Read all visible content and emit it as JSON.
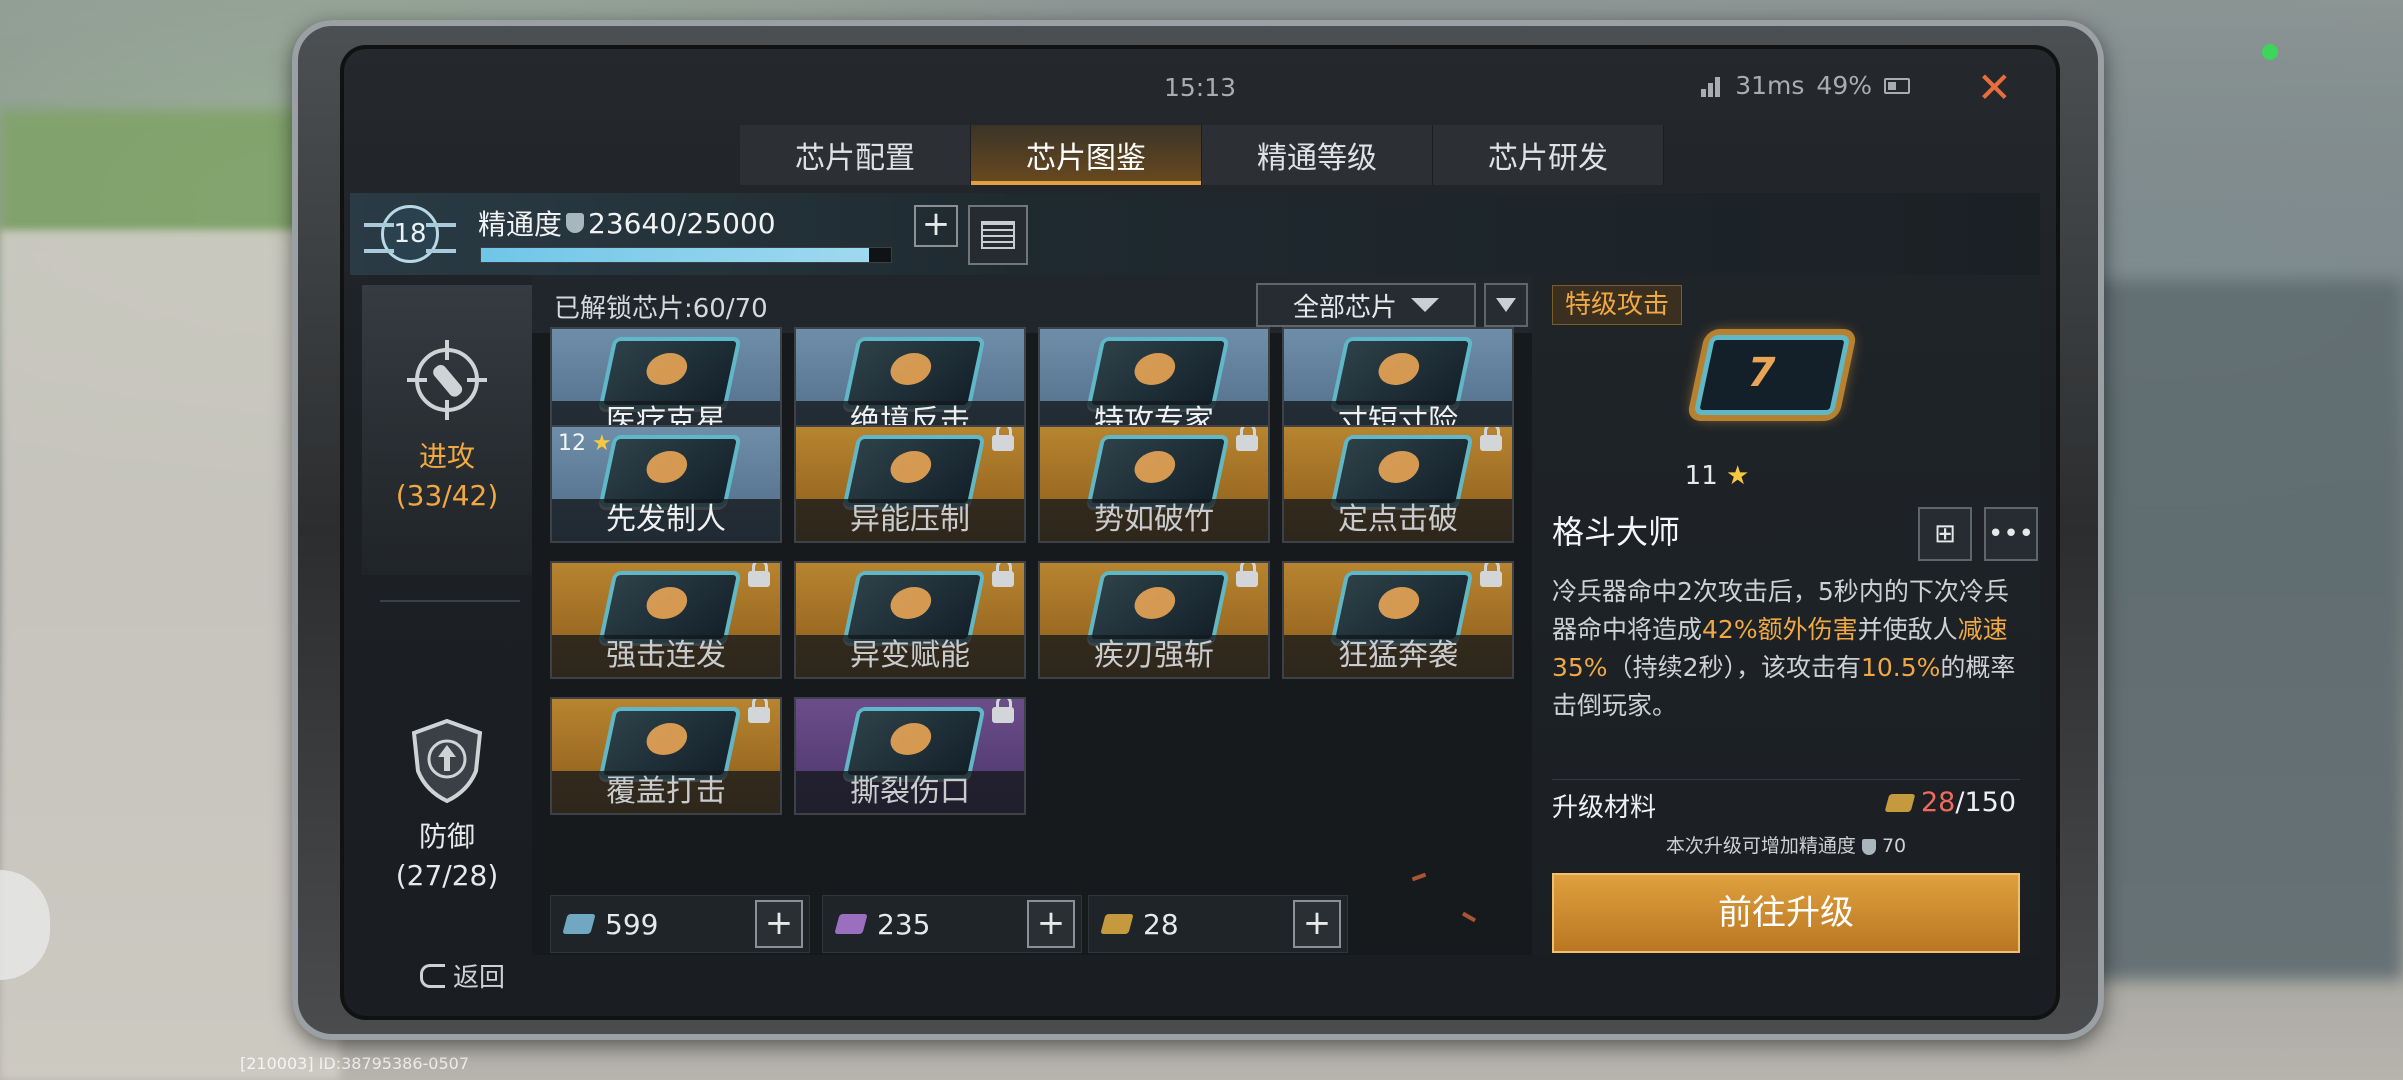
{
  "status": {
    "time": "15:13",
    "ping": "31ms",
    "battery": "49%"
  },
  "tabs": [
    {
      "label": "芯片配置",
      "active": false
    },
    {
      "label": "芯片图鉴",
      "active": true
    },
    {
      "label": "精通等级",
      "active": false
    },
    {
      "label": "芯片研发",
      "active": false
    }
  ],
  "header": {
    "level": "18",
    "mastery_label": "精通度",
    "mastery_value": "23640/25000",
    "mastery_progress": 0.9456
  },
  "categories": [
    {
      "name": "进攻",
      "count": "(33/42)",
      "active": true
    },
    {
      "name": "防御",
      "count": "(27/28)",
      "active": false
    }
  ],
  "grid": {
    "unlocked_text": "已解锁芯片:60/70",
    "filter_label": "全部芯片",
    "cards": [
      {
        "name": "医疗克星",
        "color": "blue",
        "locked": false,
        "stars": ""
      },
      {
        "name": "绝境反击",
        "color": "blue",
        "locked": false,
        "stars": ""
      },
      {
        "name": "特攻专家",
        "color": "blue",
        "locked": false,
        "stars": ""
      },
      {
        "name": "寸短寸险",
        "color": "blue",
        "locked": false,
        "stars": ""
      },
      {
        "name": "先发制人",
        "color": "blue",
        "locked": false,
        "stars": "12"
      },
      {
        "name": "异能压制",
        "color": "gold",
        "locked": true,
        "stars": ""
      },
      {
        "name": "势如破竹",
        "color": "gold",
        "locked": true,
        "stars": ""
      },
      {
        "name": "定点击破",
        "color": "gold",
        "locked": true,
        "stars": ""
      },
      {
        "name": "强击连发",
        "color": "gold",
        "locked": true,
        "stars": ""
      },
      {
        "name": "异变赋能",
        "color": "gold",
        "locked": true,
        "stars": ""
      },
      {
        "name": "疾刃强斩",
        "color": "gold",
        "locked": true,
        "stars": ""
      },
      {
        "name": "狂猛奔袭",
        "color": "gold",
        "locked": true,
        "stars": ""
      },
      {
        "name": "覆盖打击",
        "color": "gold",
        "locked": true,
        "stars": ""
      },
      {
        "name": "撕裂伤口",
        "color": "purple",
        "locked": true,
        "stars": ""
      }
    ]
  },
  "currencies": [
    {
      "value": "599",
      "color": "#6fa8c0"
    },
    {
      "value": "235",
      "color": "#9a6fc0"
    },
    {
      "value": "28",
      "color": "#c59a3e"
    }
  ],
  "detail": {
    "tag": "特级攻击",
    "stars": "11",
    "name": "格斗大师",
    "desc_parts": [
      {
        "t": "冷兵器命中2次攻击后，5秒内的下次冷兵器命中将造成",
        "hl": false
      },
      {
        "t": "42%额外伤害",
        "hl": true
      },
      {
        "t": "并使敌人",
        "hl": false
      },
      {
        "t": "减速35%",
        "hl": true
      },
      {
        "t": "（持续2秒），该攻击有",
        "hl": false
      },
      {
        "t": "10.5%",
        "hl": true
      },
      {
        "t": "的概率击倒玩家。",
        "hl": false
      }
    ],
    "material_label": "升级材料",
    "material_current": "28",
    "material_total": "/150",
    "note_text": "本次升级可增加精通度",
    "note_value": "70",
    "upgrade_label": "前往升级"
  },
  "back_label": "返回",
  "bottom_id": "[210003] ID:38795386-0507"
}
